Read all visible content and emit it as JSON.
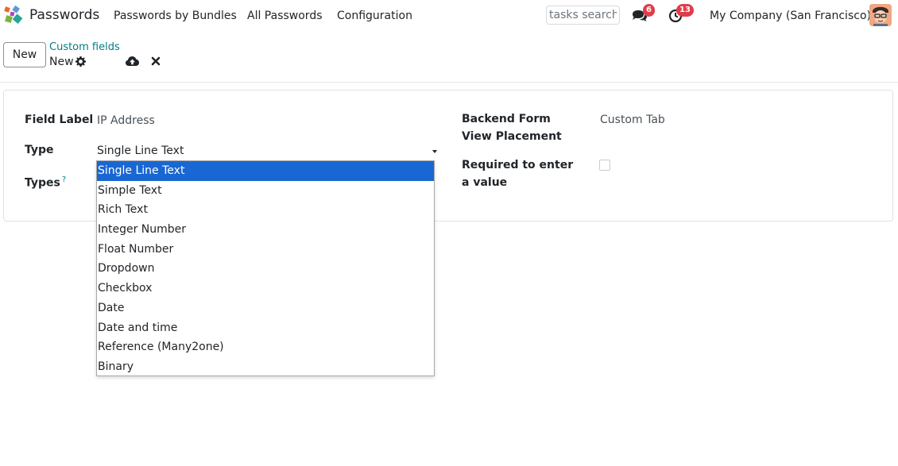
{
  "navbar": {
    "app_name": "Passwords",
    "menu": [
      "Passwords by Bundles",
      "All Passwords",
      "Configuration"
    ],
    "search_placeholder": "tasks search",
    "messages_count": "6",
    "activities_count": "13",
    "company": "My Company (San Francisco)"
  },
  "control_panel": {
    "new_label": "New",
    "breadcrumb": "Custom fields",
    "record_name": "New"
  },
  "form": {
    "field_label_label": "Field Label",
    "field_label_value": "IP Address",
    "type_label": "Type",
    "type_value": "Single Line Text",
    "types_label": "Types",
    "types_help": "?",
    "placement_label": "Backend Form View Placement",
    "placement_value": "Custom Tab",
    "required_label": "Required to enter a value"
  },
  "dropdown": {
    "options": [
      "Single Line Text",
      "Simple Text",
      "Rich Text",
      "Integer Number",
      "Float Number",
      "Dropdown",
      "Checkbox",
      "Date",
      "Date and time",
      "Reference (Many2one)",
      "Binary"
    ],
    "selected_index": 0
  },
  "colors": {
    "accent": "#017e84",
    "badge": "#e03d4a",
    "selection": "#1967d2"
  }
}
